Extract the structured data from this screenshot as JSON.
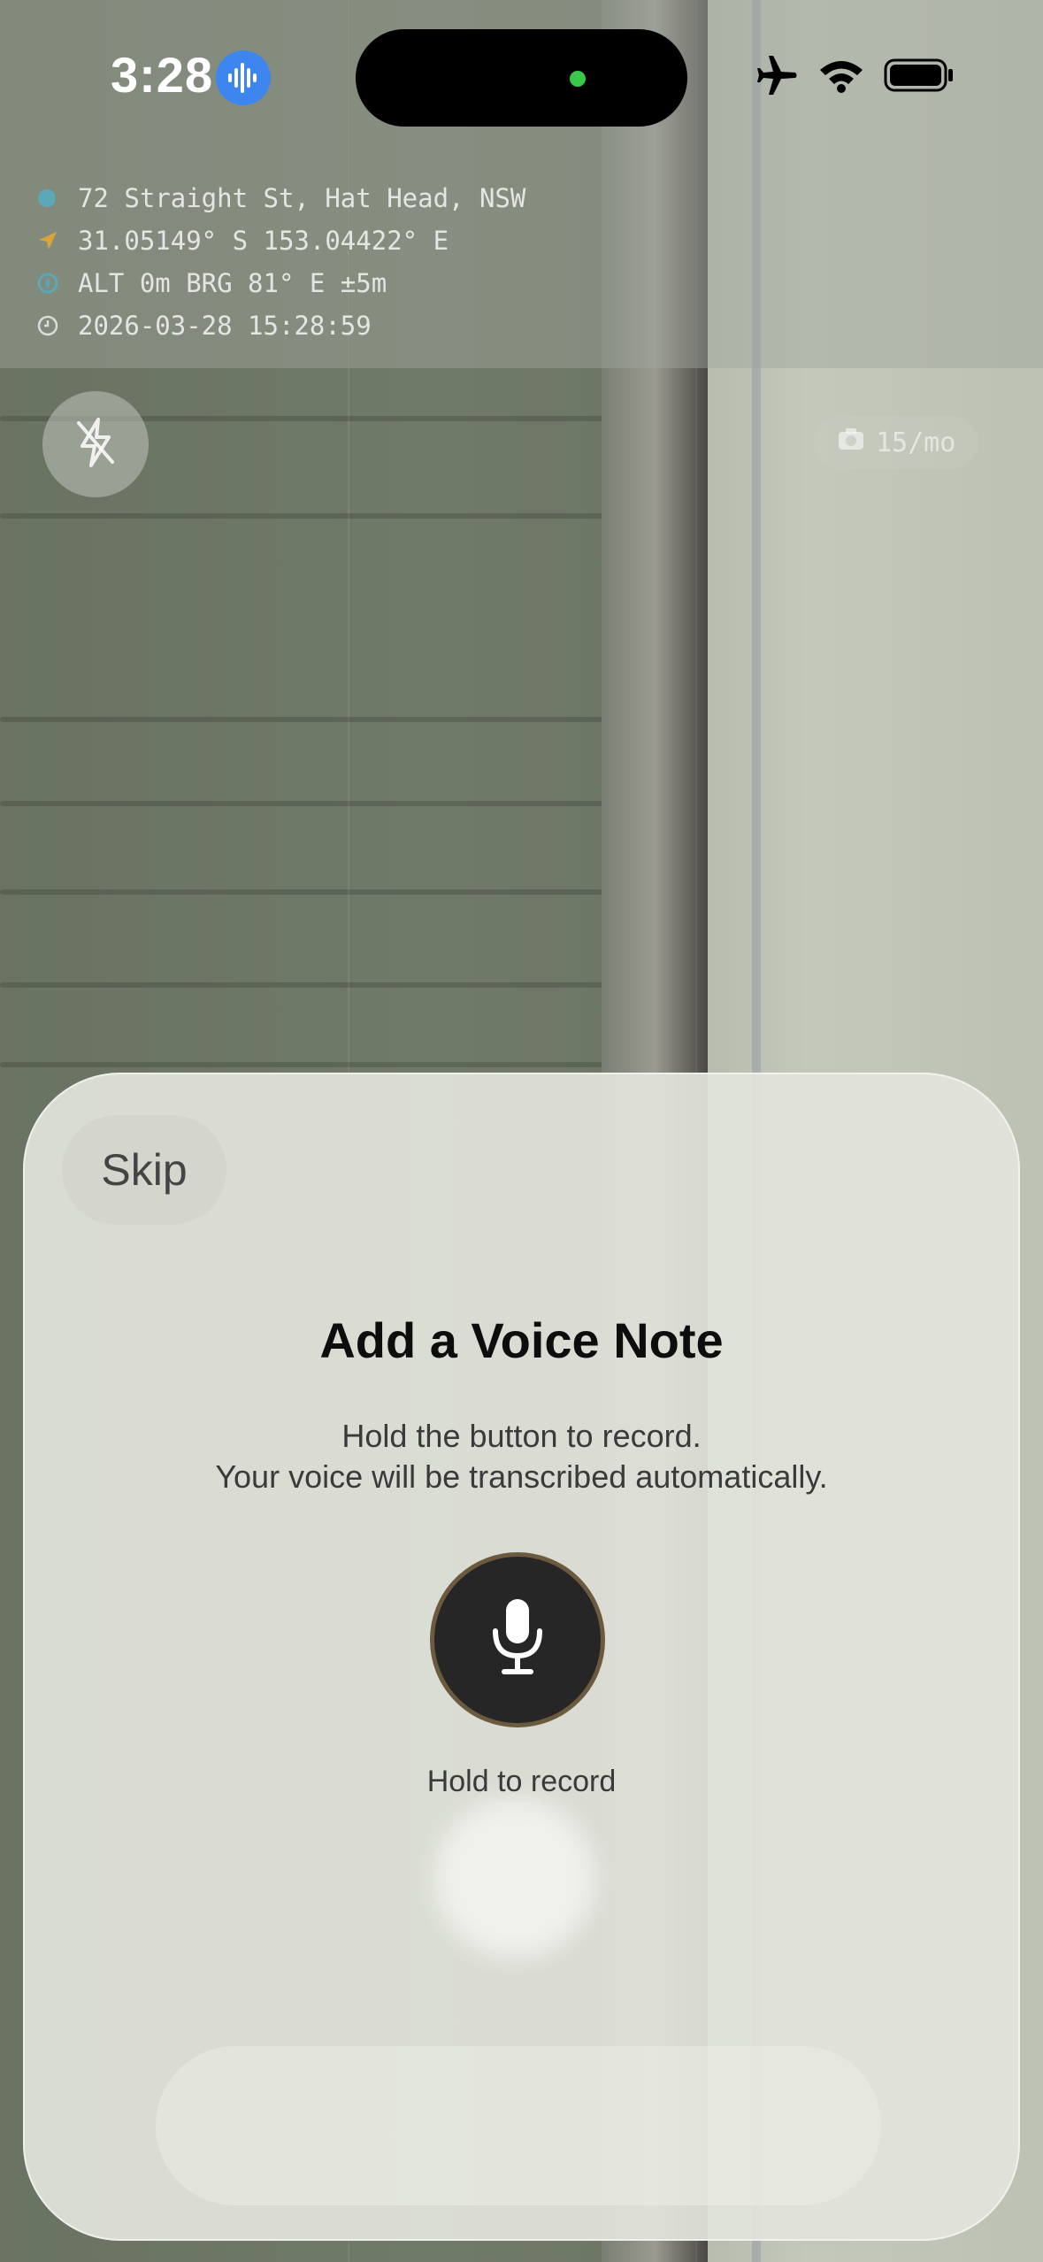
{
  "status_bar": {
    "time": "3:28",
    "icons": [
      "voice-activity-icon",
      "airplane-icon",
      "wifi-icon",
      "battery-icon"
    ]
  },
  "geo_overlay": {
    "address": "72 Straight St, Hat Head, NSW",
    "coordinates": "31.05149° S  153.04422° E",
    "altitude_bearing": "ALT 0m  BRG 81° E  ±5m",
    "timestamp": "2026-03-28 15:28:59"
  },
  "camera": {
    "quota_label": "15/mo"
  },
  "voice_sheet": {
    "skip_label": "Skip",
    "title": "Add a Voice Note",
    "description_line1": "Hold the button to record.",
    "description_line2": "Your voice will be transcribed automatically.",
    "record_hint": "Hold to record"
  },
  "colors": {
    "mic_button": "#262626",
    "mic_ring": "#6b5a3e",
    "voice_pill": "#3d86f0",
    "island_dot": "#38c94a"
  }
}
